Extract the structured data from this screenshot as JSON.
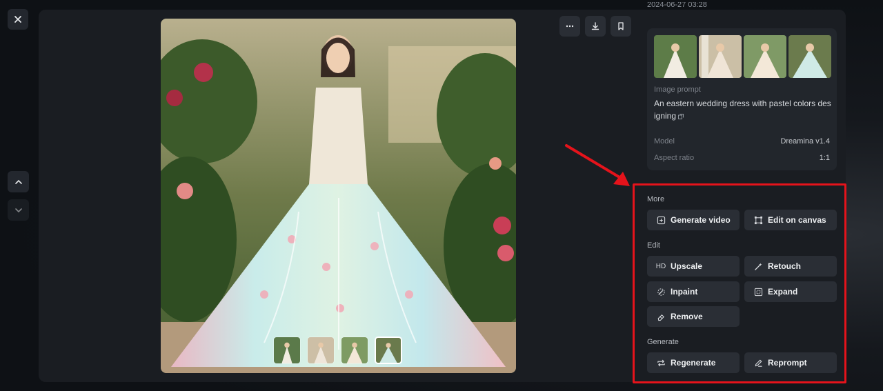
{
  "viewer": {
    "close_icon": "close-icon",
    "nav_up_icon": "chevron-up-icon",
    "nav_down_icon": "chevron-down-icon",
    "top_actions": [
      {
        "name": "more-options",
        "icon": "ellipsis-icon"
      },
      {
        "name": "download",
        "icon": "download-icon"
      },
      {
        "name": "bookmark",
        "icon": "bookmark-icon"
      }
    ],
    "thumbnail_count": 4,
    "active_thumbnail": 4
  },
  "details": {
    "cut_off_header": "2024-06-27 03:28",
    "image_prompt_label": "Image prompt",
    "image_prompt": "An eastern wedding dress with pastel colors designing",
    "model_label": "Model",
    "model_value": "Dreamina v1.4",
    "aspect_label": "Aspect ratio",
    "aspect_value": "1:1"
  },
  "actions": {
    "more_label": "More",
    "generate_video": "Generate video",
    "edit_on_canvas": "Edit on canvas",
    "edit_label": "Edit",
    "upscale_badge": "HD",
    "upscale": "Upscale",
    "retouch": "Retouch",
    "inpaint": "Inpaint",
    "expand": "Expand",
    "remove": "Remove",
    "generate_label": "Generate",
    "regenerate": "Regenerate",
    "reprompt": "Reprompt"
  },
  "annotation": {
    "highlight_color": "#e5131b"
  },
  "colors": {
    "background": "#0d1117",
    "panel": "#1a1d22",
    "card": "#22262c",
    "button": "#2a2e35"
  }
}
